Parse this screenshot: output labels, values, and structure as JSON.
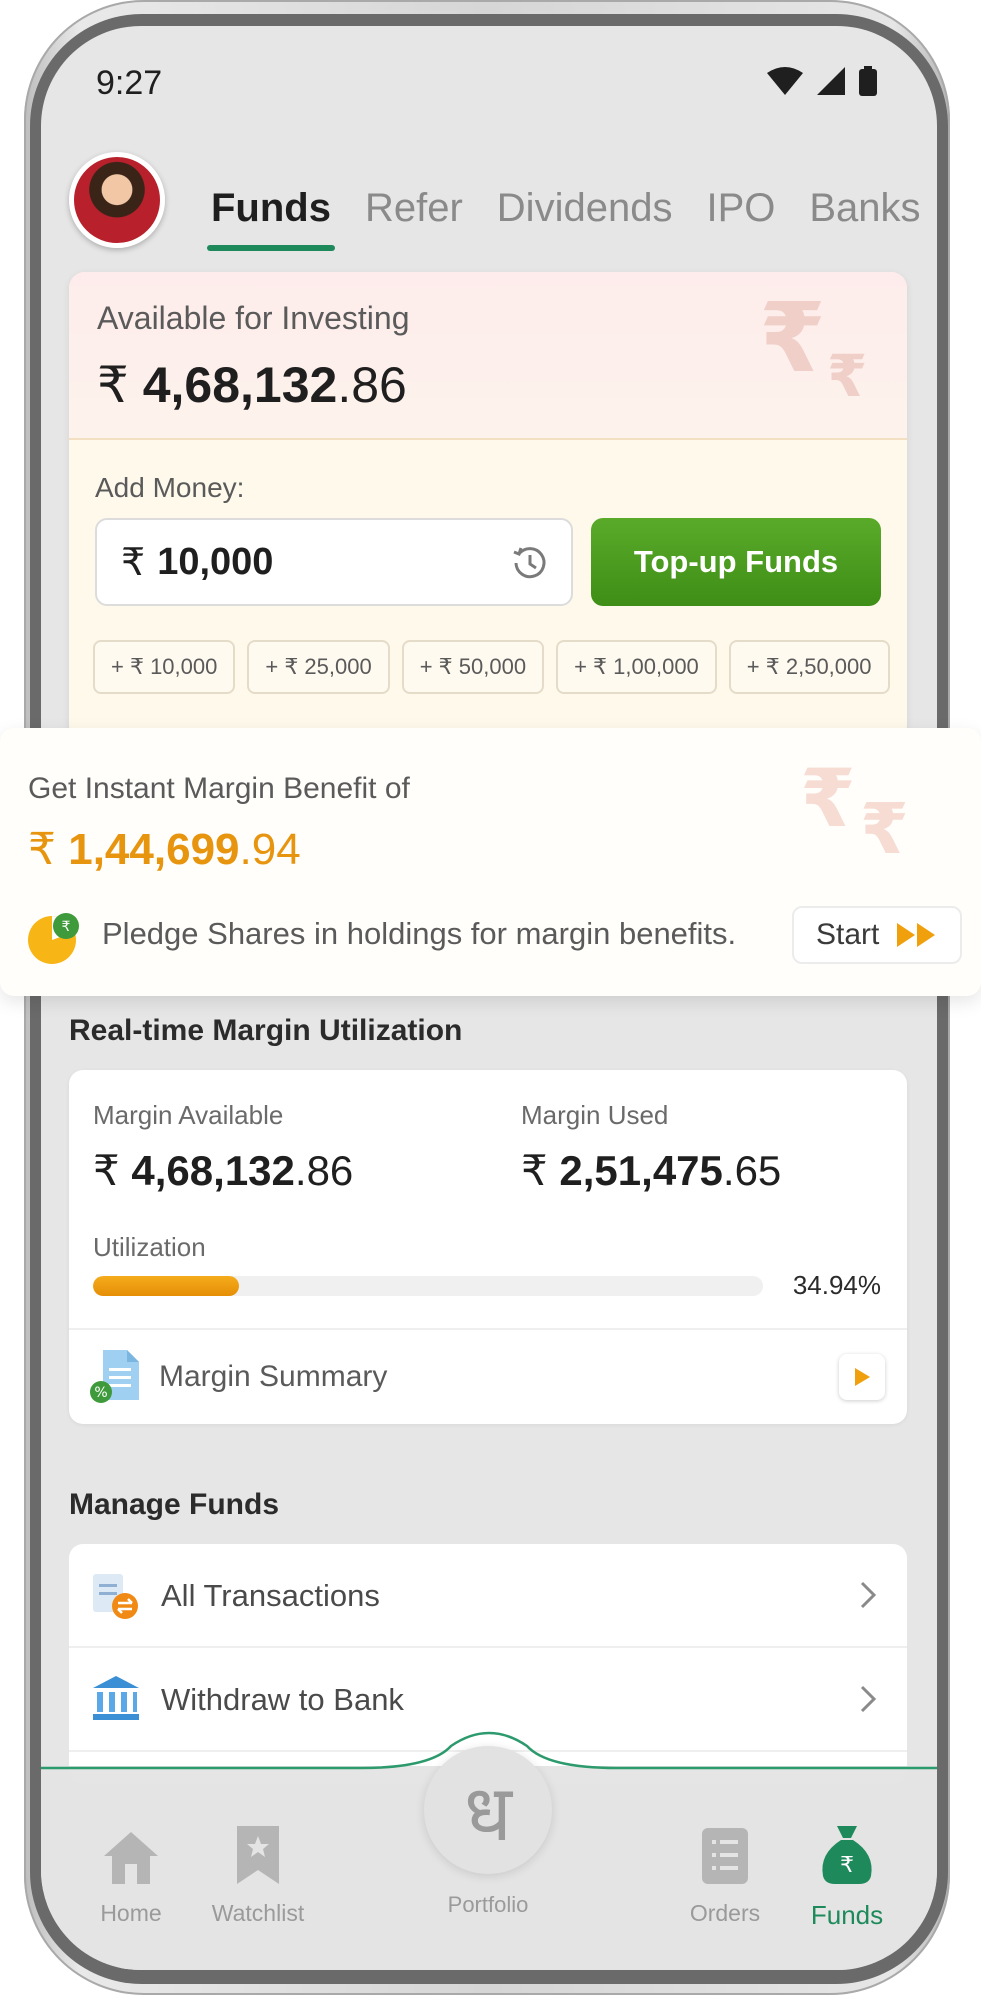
{
  "status_bar": {
    "time": "9:27"
  },
  "header": {
    "tabs": [
      {
        "label": "Funds",
        "active": true
      },
      {
        "label": "Refer"
      },
      {
        "label": "Dividends"
      },
      {
        "label": "IPO"
      },
      {
        "label": "Banks"
      }
    ]
  },
  "available": {
    "label": "Available for Investing",
    "currency": "₹",
    "amount_main": "4,68,132",
    "amount_dec": ".86"
  },
  "add_money": {
    "label": "Add Money:",
    "currency": "₹",
    "input_value": "10,000",
    "topup_label": "Top-up Funds",
    "chips": [
      "+ ₹ 10,000",
      "+ ₹ 25,000",
      "+ ₹ 50,000",
      "+ ₹ 1,00,000",
      "+ ₹ 2,50,000"
    ]
  },
  "benefit": {
    "title": "Get Instant Margin Benefit of",
    "currency": "₹",
    "amount_main": "1,44,699",
    "amount_dec": ".94",
    "pledge_text": "Pledge Shares in holdings for margin benefits.",
    "start_label": "Start"
  },
  "realtime": {
    "title": "Real-time Margin Utilization",
    "available_label": "Margin Available",
    "available_currency": "₹",
    "available_main": "4,68,132",
    "available_dec": ".86",
    "used_label": "Margin Used",
    "used_currency": "₹",
    "used_main": "2,51,475",
    "used_dec": ".65",
    "utilization_label": "Utilization",
    "utilization_pct": "34.94%",
    "utilization_fraction": 0.2185,
    "summary_label": "Margin Summary"
  },
  "manage": {
    "title": "Manage Funds",
    "items": [
      {
        "label": "All Transactions"
      },
      {
        "label": "Withdraw to Bank"
      }
    ]
  },
  "bottom_nav": {
    "items": [
      {
        "label": "Home",
        "icon": "home-icon"
      },
      {
        "label": "Watchlist",
        "icon": "bookmark-star-icon"
      },
      {
        "label": "Portfolio",
        "icon": "portfolio-logo-icon",
        "glyph": "ध"
      },
      {
        "label": "Orders",
        "icon": "orders-list-icon"
      },
      {
        "label": "Funds",
        "icon": "money-bag-icon",
        "active": true
      }
    ]
  },
  "colors": {
    "accent_green": "#1e8a5b",
    "topup_green": "#4f9f23",
    "benefit_orange": "#e7940f"
  }
}
